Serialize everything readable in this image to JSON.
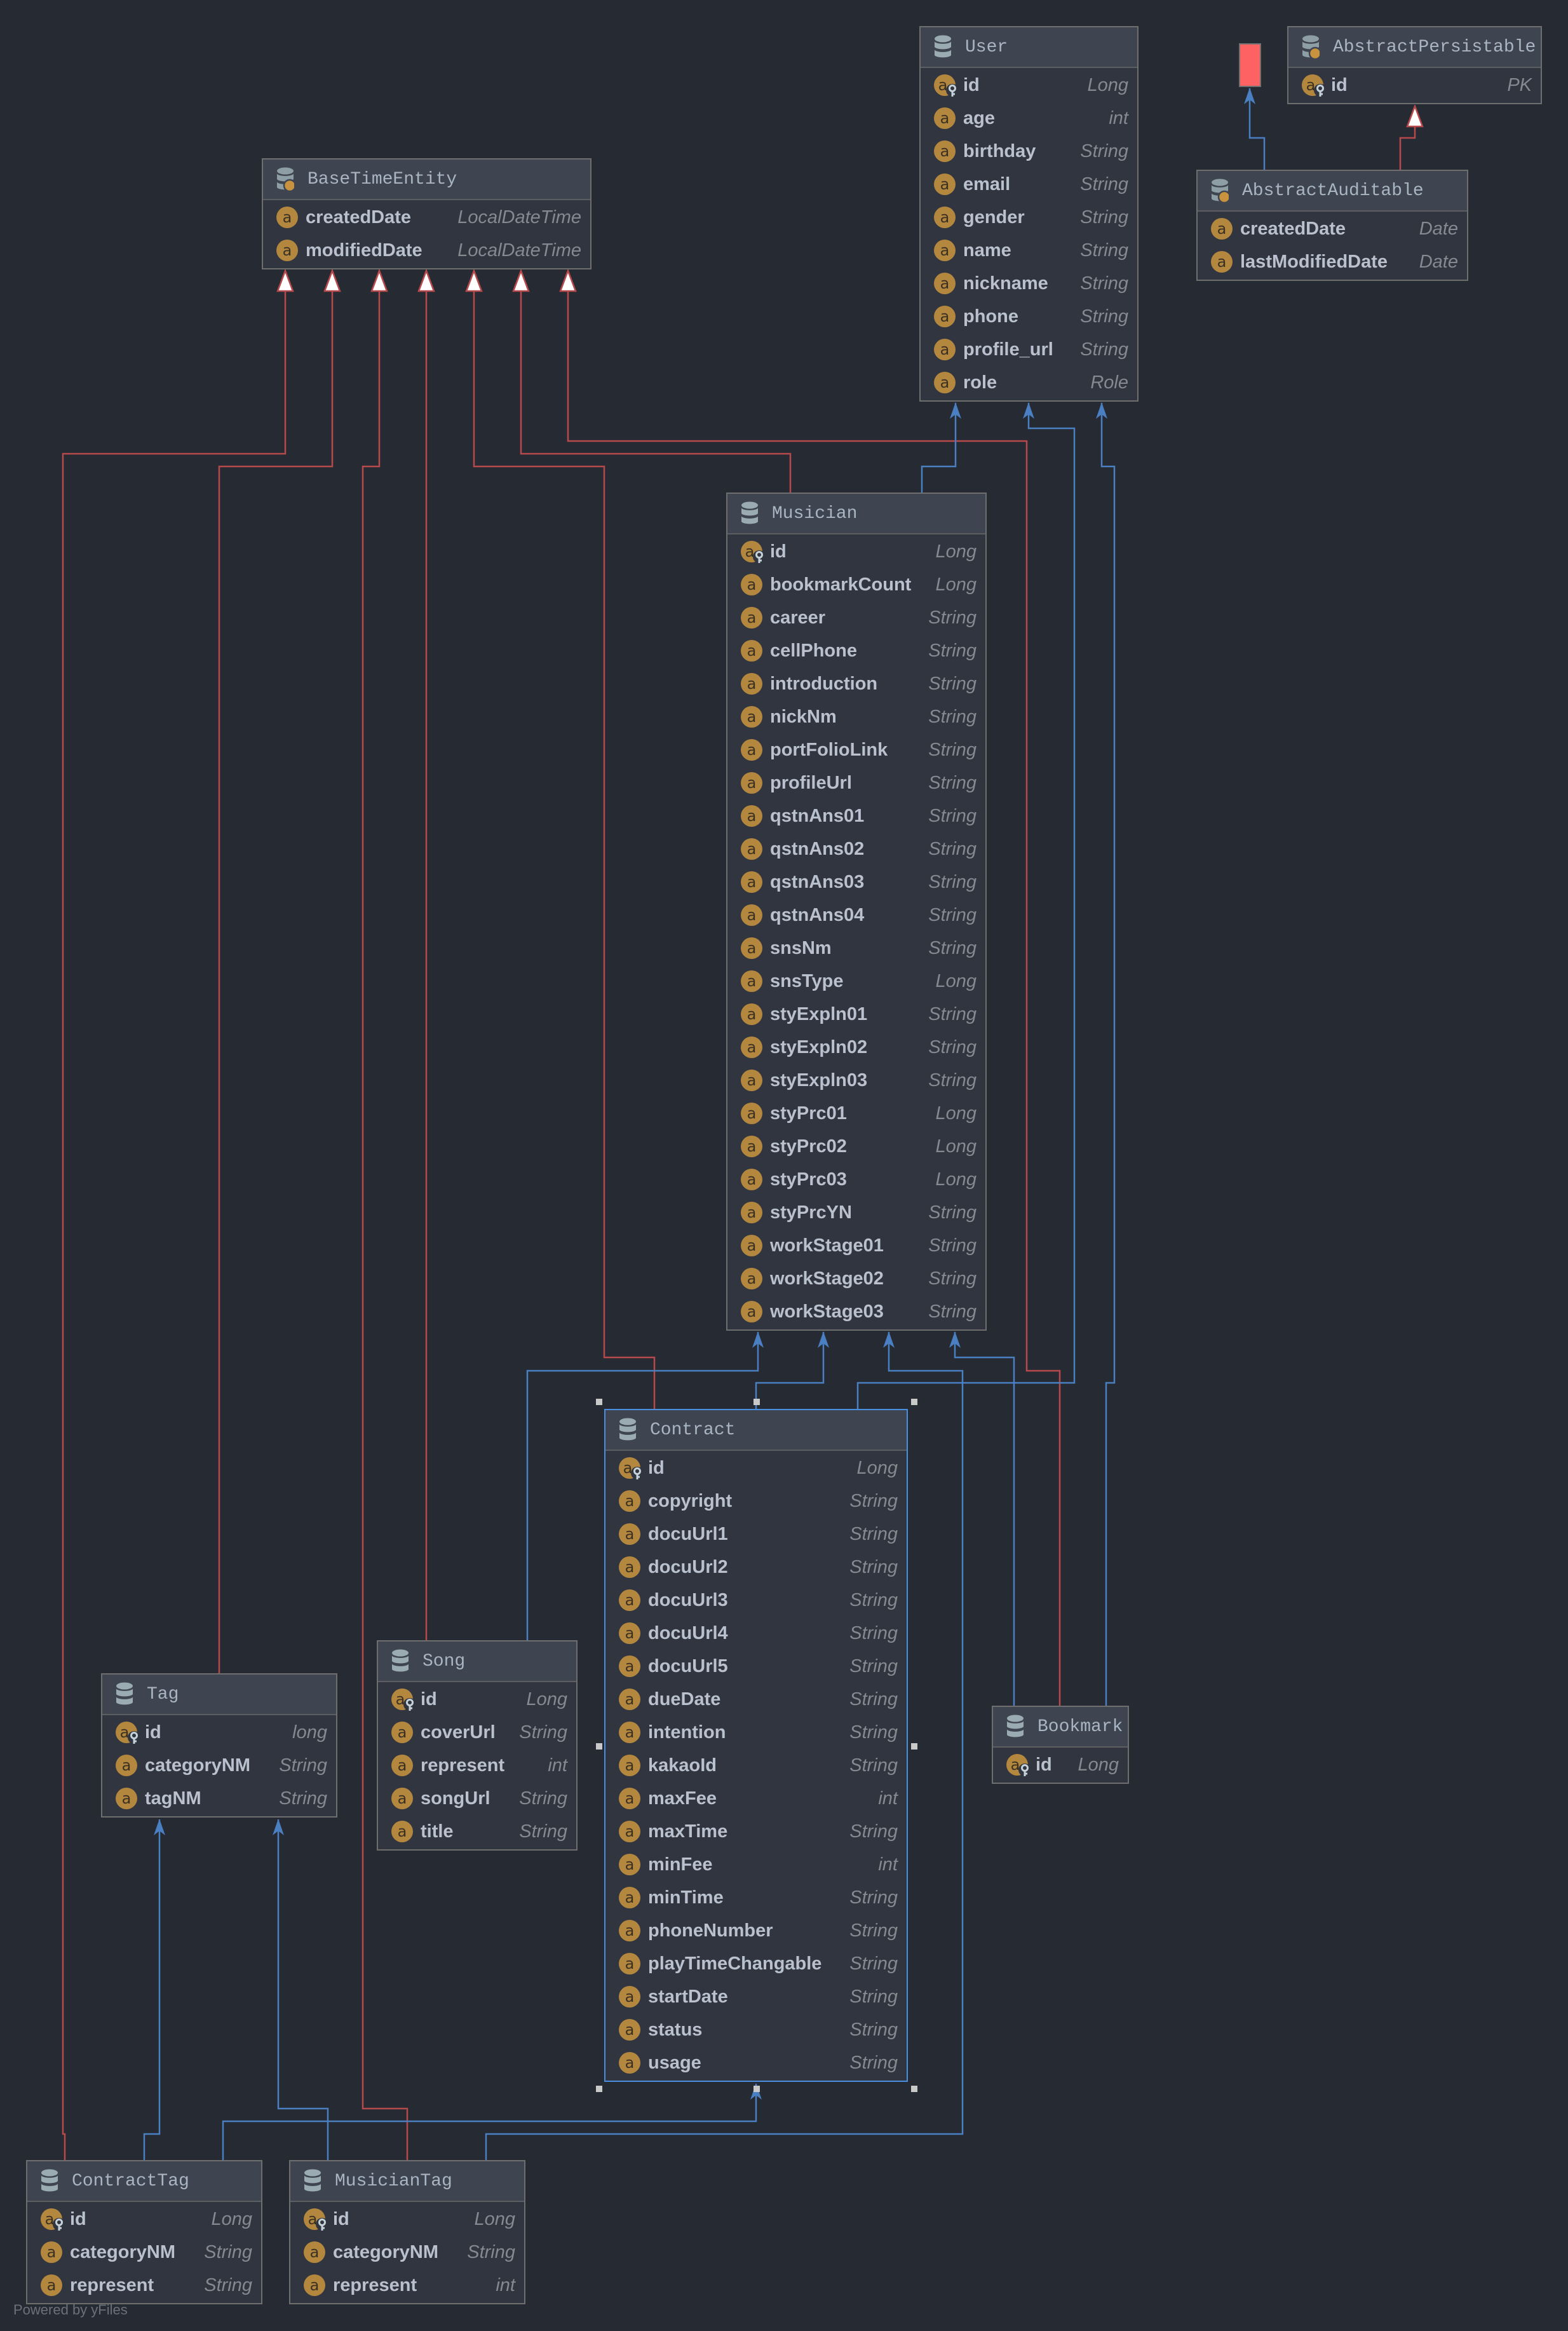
{
  "colors": {
    "inheritance": "#b5494b",
    "association": "#4a7fc1",
    "selection": "#4a8ee0"
  },
  "selected_entity": "Contract",
  "footer": "Powered by yFiles",
  "entities": {
    "user": {
      "title": "User",
      "kind": "entity",
      "fields": [
        {
          "name": "id",
          "type": "Long",
          "pk": true
        },
        {
          "name": "age",
          "type": "int"
        },
        {
          "name": "birthday",
          "type": "String"
        },
        {
          "name": "email",
          "type": "String"
        },
        {
          "name": "gender",
          "type": "String"
        },
        {
          "name": "name",
          "type": "String"
        },
        {
          "name": "nickname",
          "type": "String"
        },
        {
          "name": "phone",
          "type": "String"
        },
        {
          "name": "profile_url",
          "type": "String"
        },
        {
          "name": "role",
          "type": "Role"
        }
      ]
    },
    "abstract_persistable": {
      "title": "AbstractPersistable",
      "kind": "mapped-superclass",
      "fields": [
        {
          "name": "id",
          "type": "PK",
          "pk": true
        }
      ]
    },
    "abstract_auditable": {
      "title": "AbstractAuditable",
      "kind": "mapped-superclass",
      "fields": [
        {
          "name": "createdDate",
          "type": "Date"
        },
        {
          "name": "lastModifiedDate",
          "type": "Date"
        }
      ]
    },
    "base_time_entity": {
      "title": "BaseTimeEntity",
      "kind": "mapped-superclass",
      "fields": [
        {
          "name": "createdDate",
          "type": "LocalDateTime"
        },
        {
          "name": "modifiedDate",
          "type": "LocalDateTime"
        }
      ]
    },
    "musician": {
      "title": "Musician",
      "kind": "entity",
      "fields": [
        {
          "name": "id",
          "type": "Long",
          "pk": true
        },
        {
          "name": "bookmarkCount",
          "type": "Long"
        },
        {
          "name": "career",
          "type": "String"
        },
        {
          "name": "cellPhone",
          "type": "String"
        },
        {
          "name": "introduction",
          "type": "String"
        },
        {
          "name": "nickNm",
          "type": "String"
        },
        {
          "name": "portFolioLink",
          "type": "String"
        },
        {
          "name": "profileUrl",
          "type": "String"
        },
        {
          "name": "qstnAns01",
          "type": "String"
        },
        {
          "name": "qstnAns02",
          "type": "String"
        },
        {
          "name": "qstnAns03",
          "type": "String"
        },
        {
          "name": "qstnAns04",
          "type": "String"
        },
        {
          "name": "snsNm",
          "type": "String"
        },
        {
          "name": "snsType",
          "type": "Long"
        },
        {
          "name": "styExpln01",
          "type": "String"
        },
        {
          "name": "styExpln02",
          "type": "String"
        },
        {
          "name": "styExpln03",
          "type": "String"
        },
        {
          "name": "styPrc01",
          "type": "Long"
        },
        {
          "name": "styPrc02",
          "type": "Long"
        },
        {
          "name": "styPrc03",
          "type": "Long"
        },
        {
          "name": "styPrcYN",
          "type": "String"
        },
        {
          "name": "workStage01",
          "type": "String"
        },
        {
          "name": "workStage02",
          "type": "String"
        },
        {
          "name": "workStage03",
          "type": "String"
        }
      ]
    },
    "contract": {
      "title": "Contract",
      "kind": "entity",
      "fields": [
        {
          "name": "id",
          "type": "Long",
          "pk": true
        },
        {
          "name": "copyright",
          "type": "String"
        },
        {
          "name": "docuUrl1",
          "type": "String"
        },
        {
          "name": "docuUrl2",
          "type": "String"
        },
        {
          "name": "docuUrl3",
          "type": "String"
        },
        {
          "name": "docuUrl4",
          "type": "String"
        },
        {
          "name": "docuUrl5",
          "type": "String"
        },
        {
          "name": "dueDate",
          "type": "String"
        },
        {
          "name": "intention",
          "type": "String"
        },
        {
          "name": "kakaoId",
          "type": "String"
        },
        {
          "name": "maxFee",
          "type": "int"
        },
        {
          "name": "maxTime",
          "type": "String"
        },
        {
          "name": "minFee",
          "type": "int"
        },
        {
          "name": "minTime",
          "type": "String"
        },
        {
          "name": "phoneNumber",
          "type": "String"
        },
        {
          "name": "playTimeChangable",
          "type": "String"
        },
        {
          "name": "startDate",
          "type": "String"
        },
        {
          "name": "status",
          "type": "String"
        },
        {
          "name": "usage",
          "type": "String"
        }
      ]
    },
    "tag": {
      "title": "Tag",
      "kind": "entity",
      "fields": [
        {
          "name": "id",
          "type": "long",
          "pk": true
        },
        {
          "name": "categoryNM",
          "type": "String"
        },
        {
          "name": "tagNM",
          "type": "String"
        }
      ]
    },
    "song": {
      "title": "Song",
      "kind": "entity",
      "fields": [
        {
          "name": "id",
          "type": "Long",
          "pk": true
        },
        {
          "name": "coverUrl",
          "type": "String"
        },
        {
          "name": "represent",
          "type": "int"
        },
        {
          "name": "songUrl",
          "type": "String"
        },
        {
          "name": "title",
          "type": "String"
        }
      ]
    },
    "bookmark": {
      "title": "Bookmark",
      "kind": "entity",
      "fields": [
        {
          "name": "id",
          "type": "Long",
          "pk": true
        }
      ]
    },
    "contract_tag": {
      "title": "ContractTag",
      "kind": "entity",
      "fields": [
        {
          "name": "id",
          "type": "Long",
          "pk": true
        },
        {
          "name": "categoryNM",
          "type": "String"
        },
        {
          "name": "represent",
          "type": "String"
        }
      ]
    },
    "musician_tag": {
      "title": "MusicianTag",
      "kind": "entity",
      "fields": [
        {
          "name": "id",
          "type": "Long",
          "pk": true
        },
        {
          "name": "categoryNM",
          "type": "String"
        },
        {
          "name": "represent",
          "type": "int"
        }
      ]
    }
  },
  "relations": [
    {
      "from": "ContractTag",
      "to": "BaseTimeEntity",
      "kind": "inheritance"
    },
    {
      "from": "Tag",
      "to": "BaseTimeEntity",
      "kind": "inheritance"
    },
    {
      "from": "MusicianTag",
      "to": "BaseTimeEntity",
      "kind": "inheritance"
    },
    {
      "from": "Song",
      "to": "BaseTimeEntity",
      "kind": "inheritance"
    },
    {
      "from": "Contract",
      "to": "BaseTimeEntity",
      "kind": "inheritance"
    },
    {
      "from": "Musician",
      "to": "BaseTimeEntity",
      "kind": "inheritance"
    },
    {
      "from": "Bookmark",
      "to": "BaseTimeEntity",
      "kind": "inheritance"
    },
    {
      "from": "AbstractAuditable",
      "to": "AbstractPersistable",
      "kind": "inheritance"
    },
    {
      "from": "Musician",
      "to": "User",
      "kind": "association"
    },
    {
      "from": "Contract",
      "to": "User",
      "kind": "association"
    },
    {
      "from": "Bookmark",
      "to": "User",
      "kind": "association"
    },
    {
      "from": "Song",
      "to": "Musician",
      "kind": "association"
    },
    {
      "from": "Contract",
      "to": "Musician",
      "kind": "association"
    },
    {
      "from": "MusicianTag",
      "to": "Musician",
      "kind": "association"
    },
    {
      "from": "Bookmark",
      "to": "Musician",
      "kind": "association"
    },
    {
      "from": "ContractTag",
      "to": "Contract",
      "kind": "association"
    },
    {
      "from": "ContractTag",
      "to": "Tag",
      "kind": "association"
    },
    {
      "from": "MusicianTag",
      "to": "Tag",
      "kind": "association"
    },
    {
      "from": "AbstractAuditable",
      "to": "(unnamed node)",
      "kind": "association"
    }
  ]
}
